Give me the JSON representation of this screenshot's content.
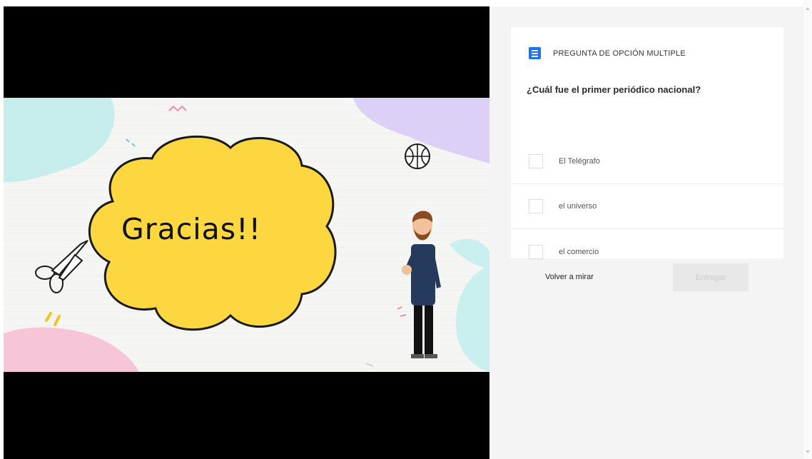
{
  "slide": {
    "title": "Gracias!!"
  },
  "question": {
    "type_label": "PREGUNTA DE OPCIÓN MULTIPLE",
    "type_icon": "list-icon",
    "text": "¿Cuál fue el primer periódico nacional?",
    "options": [
      {
        "label": "El Telégrafo"
      },
      {
        "label": "el universo"
      },
      {
        "label": "el comercio"
      }
    ]
  },
  "actions": {
    "rewatch_label": "Volver a mirar",
    "submit_label": "Entregar"
  },
  "colors": {
    "accent": "#1a73e8",
    "cloud": "#fcd740",
    "panel_bg": "#f4f4f4"
  }
}
